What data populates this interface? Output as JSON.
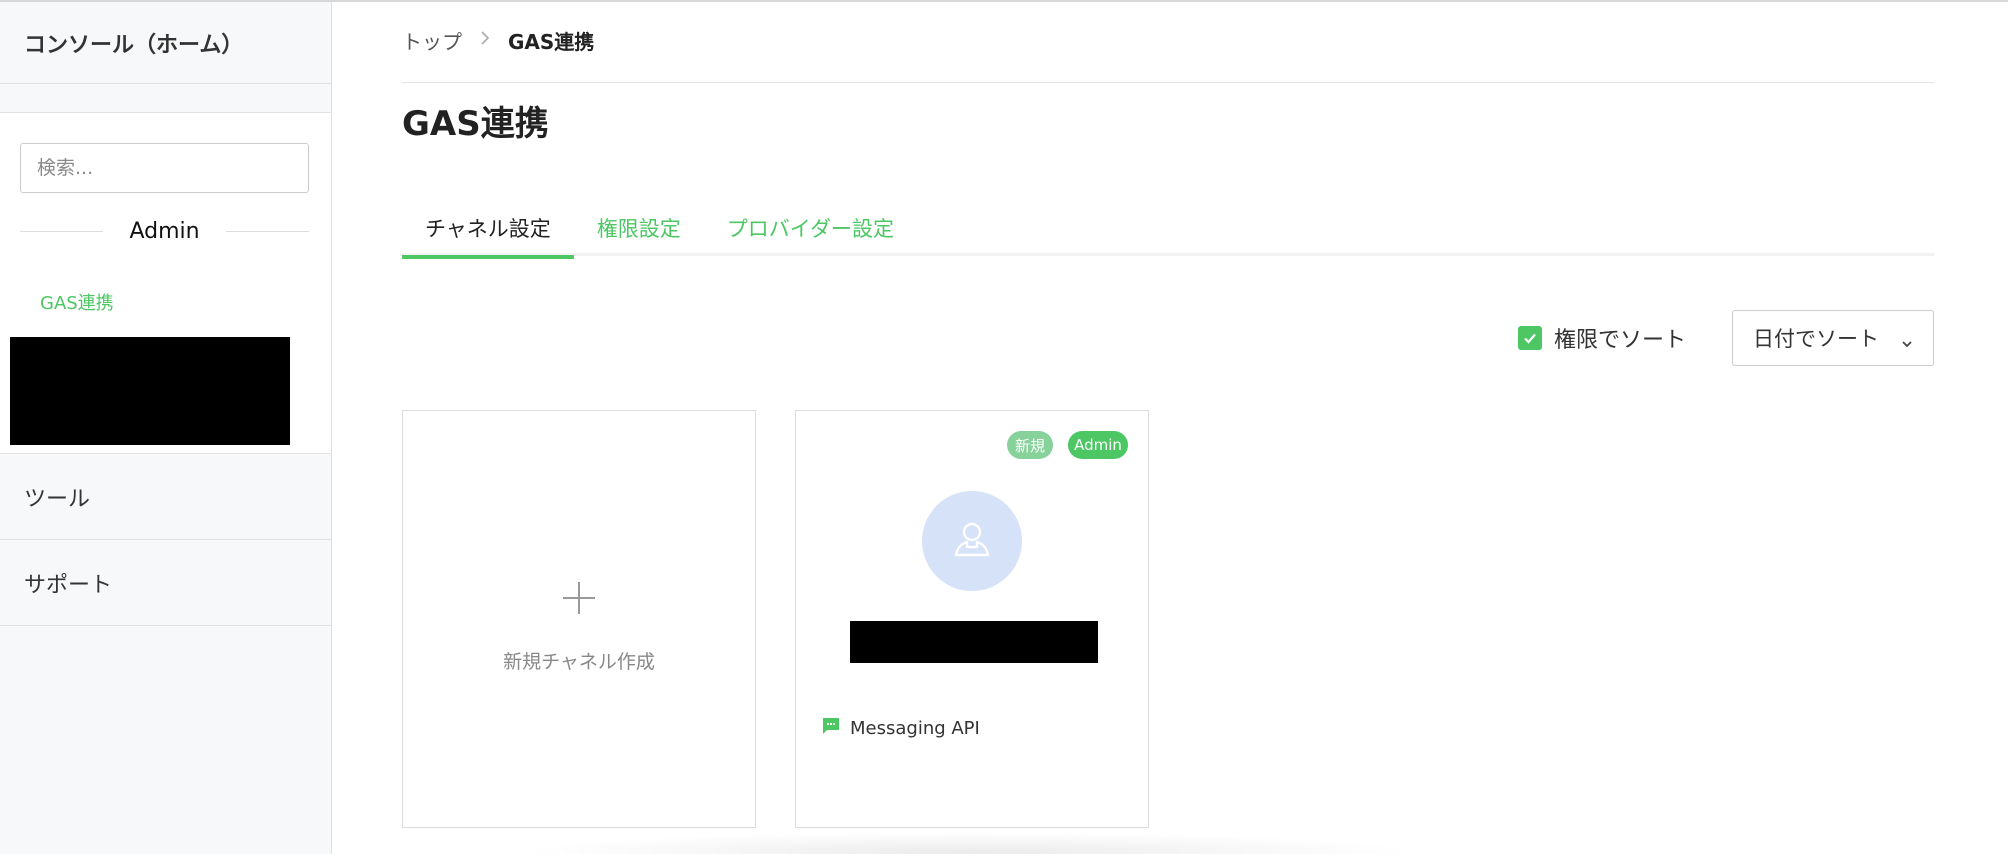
{
  "sidebar": {
    "home_label": "コンソール（ホーム）",
    "search_placeholder": "検索...",
    "section_label": "Admin",
    "provider_link": "GAS連携",
    "items": [
      {
        "label": "ツール"
      },
      {
        "label": "サポート"
      }
    ]
  },
  "breadcrumb": {
    "top": "トップ",
    "separator": "›",
    "current": "GAS連携"
  },
  "page": {
    "title": "GAS連携"
  },
  "tabs": [
    {
      "label": "チャネル設定",
      "active": true
    },
    {
      "label": "権限設定",
      "active": false
    },
    {
      "label": "プロバイダー設定",
      "active": false
    }
  ],
  "sort": {
    "checkbox_label": "権限でソート",
    "checked": true,
    "select_value": "日付でソート"
  },
  "cards": {
    "new_channel_label": "新規チャネル作成",
    "channel": {
      "badge_new": "新規",
      "badge_admin": "Admin",
      "type_label": "Messaging API"
    }
  },
  "colors": {
    "accent": "#4cc764",
    "badge_new": "#86d29a",
    "avatar_bg": "#d5e2f7"
  },
  "icons": [
    "chevron-right-icon",
    "checkmark-icon",
    "chevron-down-icon",
    "plus-icon",
    "user-icon",
    "chat-bubble-icon"
  ]
}
